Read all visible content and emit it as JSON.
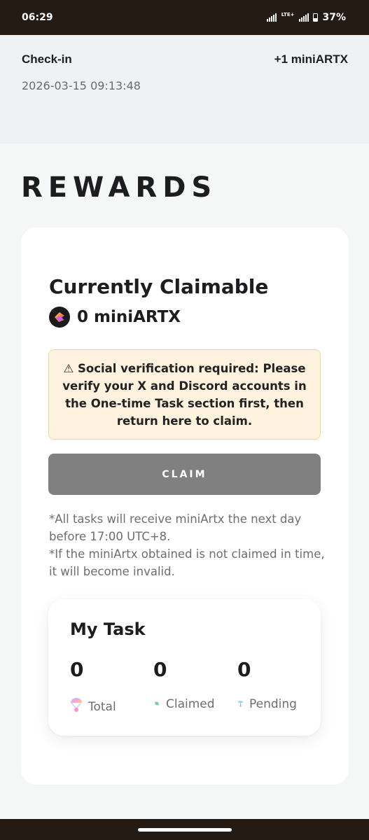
{
  "status_bar": {
    "time": "06:29",
    "network": "LTE+",
    "battery": "37%"
  },
  "checkin": {
    "title": "Check-in",
    "reward": "+1 miniARTX",
    "timestamp": "2026-03-15 09:13:48"
  },
  "page": {
    "heading": "REWARDS"
  },
  "claimable": {
    "title": "Currently Claimable",
    "token_icon": "miniartx-token-icon",
    "balance": "0 miniARTX"
  },
  "warning": {
    "icon": "⚠",
    "message": "Social verification required: Please verify your X and Discord accounts in the One-time Task section first, then return here to claim."
  },
  "claim_button": {
    "label": "CLAIM"
  },
  "notes": [
    "*All tasks will receive miniArtx the next day before 17:00 UTC+8.",
    "*If the miniArtx obtained is not claimed in time, it will become invalid."
  ],
  "my_task": {
    "title": "My Task",
    "stats": [
      {
        "value": "0",
        "label": "Total",
        "icon": "parachute-icon"
      },
      {
        "value": "0",
        "label": "Claimed",
        "icon": "sparkle-dot-icon"
      },
      {
        "value": "0",
        "label": "Pending",
        "icon": "small-parachute-icon"
      }
    ]
  },
  "colors": {
    "status_bar_bg": "#241c14",
    "page_bg": "#f4f7f6",
    "checkin_bg": "#eef2f2",
    "warning_bg": "#fff3df",
    "warning_border": "#f1d69c",
    "claim_button_bg": "#808080"
  }
}
